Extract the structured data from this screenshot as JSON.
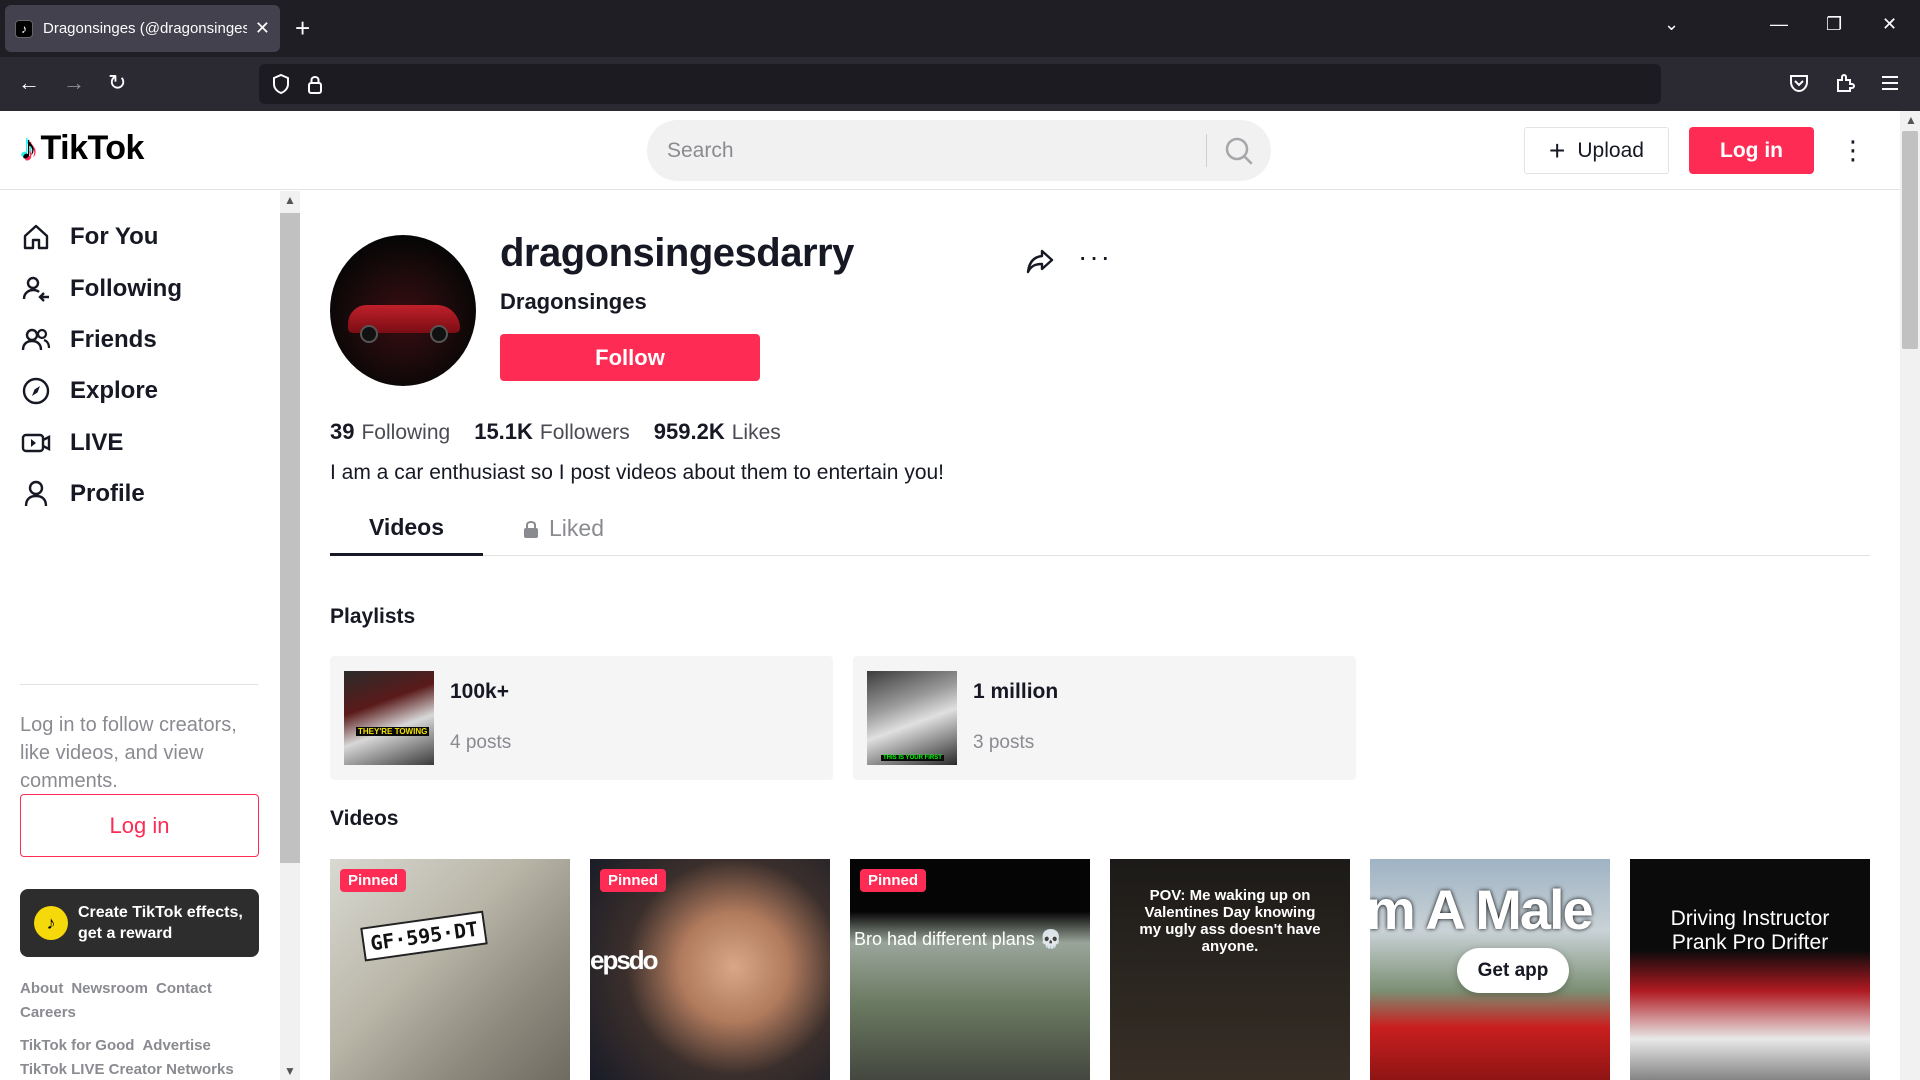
{
  "browser": {
    "tab_title": "Dragonsinges (@dragonsingesdarry) | TikTok",
    "new_tab": "+"
  },
  "header": {
    "logo_text": "TikTok",
    "search_placeholder": "Search",
    "upload_label": "Upload",
    "login_label": "Log in"
  },
  "sidebar": {
    "items": [
      {
        "label": "For You",
        "icon": "home-icon"
      },
      {
        "label": "Following",
        "icon": "following-icon"
      },
      {
        "label": "Friends",
        "icon": "friends-icon"
      },
      {
        "label": "Explore",
        "icon": "compass-icon"
      },
      {
        "label": "LIVE",
        "icon": "live-icon"
      },
      {
        "label": "Profile",
        "icon": "profile-icon"
      }
    ],
    "login_prompt": "Log in to follow creators, like videos, and view comments.",
    "login_label": "Log in",
    "effects_label": "Create TikTok effects, get a reward",
    "footer_row1": [
      "About",
      "Newsroom",
      "Contact"
    ],
    "footer_row2": [
      "Careers"
    ],
    "footer_row3": [
      "TikTok for Good",
      "Advertise"
    ],
    "footer_row4": [
      "TikTok LIVE Creator Networks"
    ]
  },
  "profile": {
    "username": "dragonsingesdarry",
    "nickname": "Dragonsinges",
    "follow_label": "Follow",
    "following_count": "39",
    "following_label": "Following",
    "followers_count": "15.1K",
    "followers_label": "Followers",
    "likes_count": "959.2K",
    "likes_label": "Likes",
    "bio": "I am a car enthusiast so I post videos about them to entertain you!"
  },
  "tabs": {
    "videos": "Videos",
    "liked": "Liked"
  },
  "playlists": {
    "title": "Playlists",
    "items": [
      {
        "name": "100k+",
        "count": "4 posts",
        "thumb_caption": "THEY'RE TOWING"
      },
      {
        "name": "1 million",
        "count": "3 posts",
        "thumb_caption": "THIS IS YOUR FIRST"
      }
    ]
  },
  "videos": {
    "title": "Videos",
    "items": [
      {
        "badge": "Pinned",
        "caption": "GF·595·DT"
      },
      {
        "badge": "Pinned",
        "caption": "epsdo"
      },
      {
        "badge": "Pinned",
        "caption": "Bro had different plans 💀"
      },
      {
        "badge": "",
        "caption": "POV: Me waking up on Valentines Day knowing my ugly ass doesn't have anyone."
      },
      {
        "badge": "",
        "caption": "m A Male"
      },
      {
        "badge": "",
        "caption": "Driving Instructor Prank Pro Drifter"
      }
    ],
    "get_app": "Get app"
  },
  "colors": {
    "brand": "#fe2c55",
    "text": "#161823",
    "muted": "#8a8b91"
  }
}
